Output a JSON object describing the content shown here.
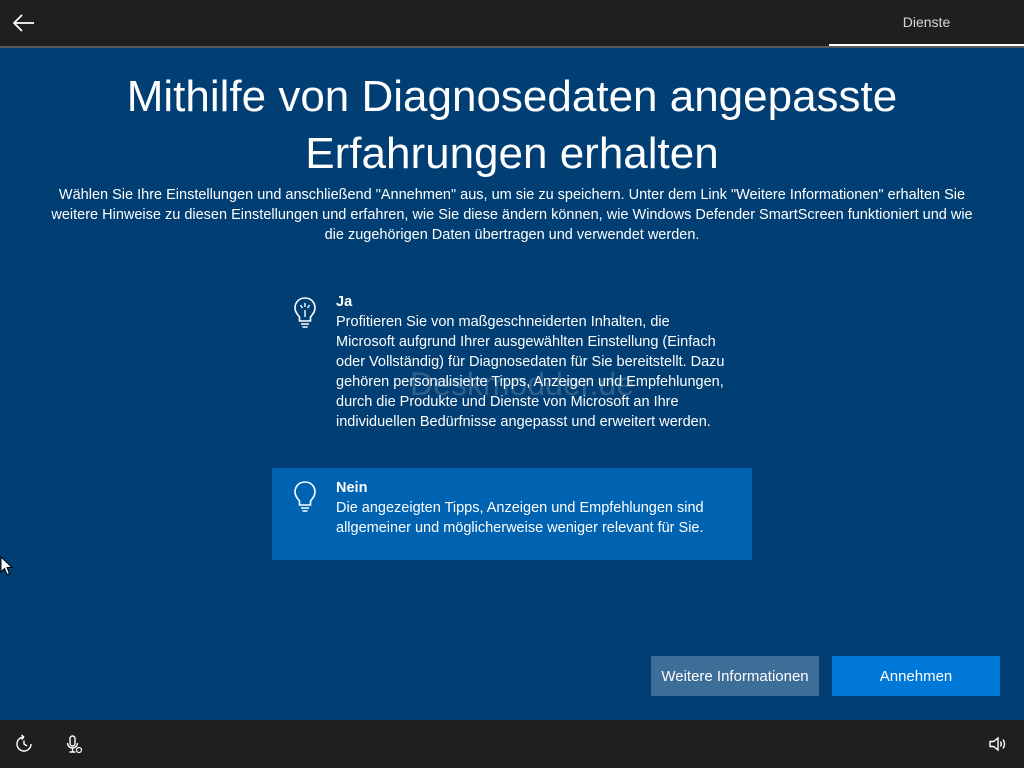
{
  "header": {
    "tab_label": "Dienste"
  },
  "main": {
    "title_line1": "Mithilfe von Diagnosedaten angepasste",
    "title_line2": "Erfahrungen erhalten",
    "description": "Wählen Sie Ihre Einstellungen und anschließend \"Annehmen\" aus, um sie zu speichern. Unter dem Link \"Weitere Informationen\" erhalten Sie weitere Hinweise zu diesen Einstellungen und erfahren, wie Sie diese ändern können, wie Windows Defender SmartScreen funktioniert und wie die zugehörigen Daten übertragen und verwendet werden.",
    "options": [
      {
        "label": "Ja",
        "text": "Profitieren Sie von maßgeschneiderten Inhalten, die Microsoft aufgrund Ihrer ausgewählten Einstellung (Einfach oder Vollständig) für Diagnosedaten für Sie bereitstellt. Dazu gehören personalisierte Tipps, Anzeigen und Empfehlungen, durch die Produkte und Dienste von Microsoft an Ihre individuellen Bedürfnisse angepasst und erweitert werden.",
        "icon": "lightbulb-on-icon",
        "selected": false
      },
      {
        "label": "Nein",
        "text": "Die angezeigten Tipps, Anzeigen und Empfehlungen sind allgemeiner und möglicherweise weniger relevant für Sie.",
        "icon": "lightbulb-off-icon",
        "selected": true
      }
    ],
    "watermark": "Deskmodder.de"
  },
  "footer": {
    "more_info_label": "Weitere Informationen",
    "accept_label": "Annehmen"
  },
  "taskbar": {
    "icons": [
      "ease-of-access-icon",
      "microphone-icon",
      "volume-icon"
    ]
  },
  "colors": {
    "background": "#003e73",
    "selected_option": "#0063b1",
    "accent_button": "#0078d7",
    "secondary_button": "#3d6e98",
    "bar": "#1f1f1f"
  }
}
